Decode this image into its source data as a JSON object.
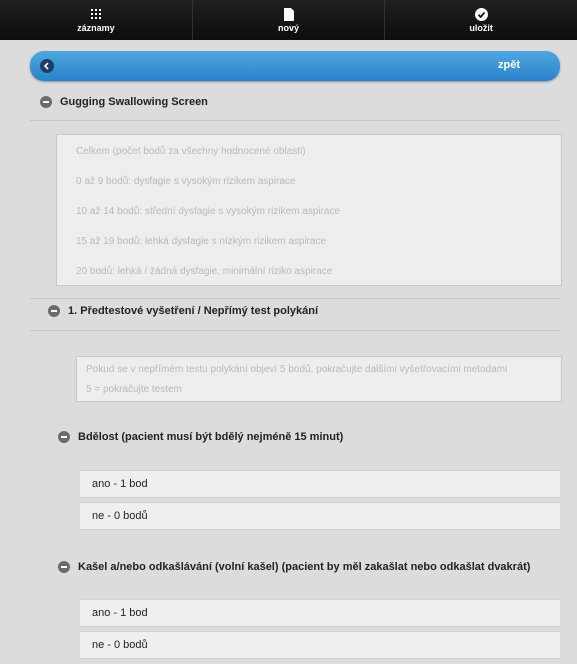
{
  "toolbar": {
    "items": [
      {
        "label": "záznamy",
        "icon": "grid-icon"
      },
      {
        "label": "nový",
        "icon": "new-document-icon"
      },
      {
        "label": "uložit",
        "icon": "checkmark-icon"
      }
    ]
  },
  "header": {
    "back_label": "zpět"
  },
  "section_main": {
    "title": "Gugging Swallowing Screen",
    "faded_lines": [
      "Celkem (počet bodů za všechny hodnocené oblasti)",
      "0 až 9 bodů: dysfagie s vysokým rizikem aspirace",
      "10 až 14 bodů: střední dysfagie s vysokým rizikem aspirace",
      "15 až 19 bodů: lehká dysfagie s nízkým rizikem aspirace",
      "20 bodů: lehká / žádná dysfagie, minimální riziko aspirace"
    ]
  },
  "section_pretest": {
    "title": "1. Předtestové vyšetření / Nepřímý test polykání",
    "faded_lines": [
      "Pokud se v nepřímém testu polykání objeví 5 bodů, pokračujte dalšími vyšetřovacími metodami",
      "5 = pokračujte testem"
    ]
  },
  "question_alertness": {
    "title": "Bdělost (pacient musí být bdělý nejméně 15 minut)",
    "options": [
      "ano - 1 bod",
      "ne - 0 bodů"
    ]
  },
  "question_cough": {
    "title": "Kašel a/nebo odkašlávání (volní kašel) (pacient by měl zakašlat nebo odkašlat dvakrát)",
    "options": [
      "ano - 1 bod",
      "ne - 0 bodů"
    ]
  }
}
